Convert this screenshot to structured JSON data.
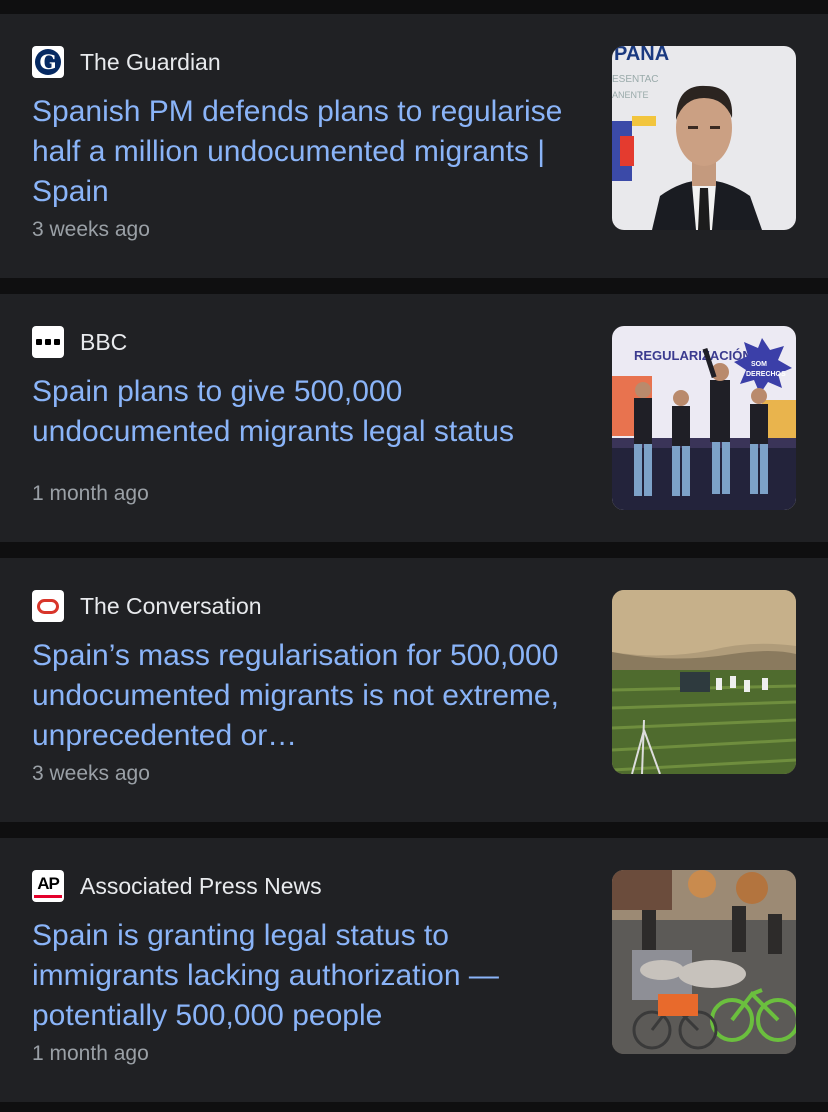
{
  "articles": [
    {
      "source": "The Guardian",
      "logo_icon": "guardian-logo-icon",
      "headline": "Spanish PM defends plans to regularise half a million undocumented migrants | Spain",
      "time": "3 weeks ago",
      "thumbnail": "portrait-of-spanish-pm-image",
      "thumbnail_text": "PANA ESENTAC ANENTE"
    },
    {
      "source": "BBC",
      "logo_icon": "bbc-logo-icon",
      "headline": "Spain plans to give 500,000 undocumented migrants legal status",
      "time": "1 month ago",
      "thumbnail": "rally-on-stage-image",
      "thumbnail_text": "REGULARIZACIÓN",
      "thumbnail_badge": "SOM DERECHOS"
    },
    {
      "source": "The Conversation",
      "logo_icon": "conversation-logo-icon",
      "headline": "Spain’s mass regularisation for 500,000 undocumented migrants is not extreme, unprecedented or…",
      "time": "3 weeks ago",
      "thumbnail": "farm-field-workers-image"
    },
    {
      "source": "Associated Press News",
      "logo_icon": "ap-logo-icon",
      "headline": "Spain is granting legal status to immigrants lacking authorization — potentially 500,000 people",
      "time": "1 month ago",
      "thumbnail": "street-bicycles-image"
    }
  ],
  "logos": {
    "guardian_letter": "G",
    "ap_text": "AP"
  },
  "colors": {
    "background": "#0f0f10",
    "card": "#202124",
    "headline": "#8ab4f8",
    "source": "#e8eaed",
    "time": "#9aa0a6"
  }
}
